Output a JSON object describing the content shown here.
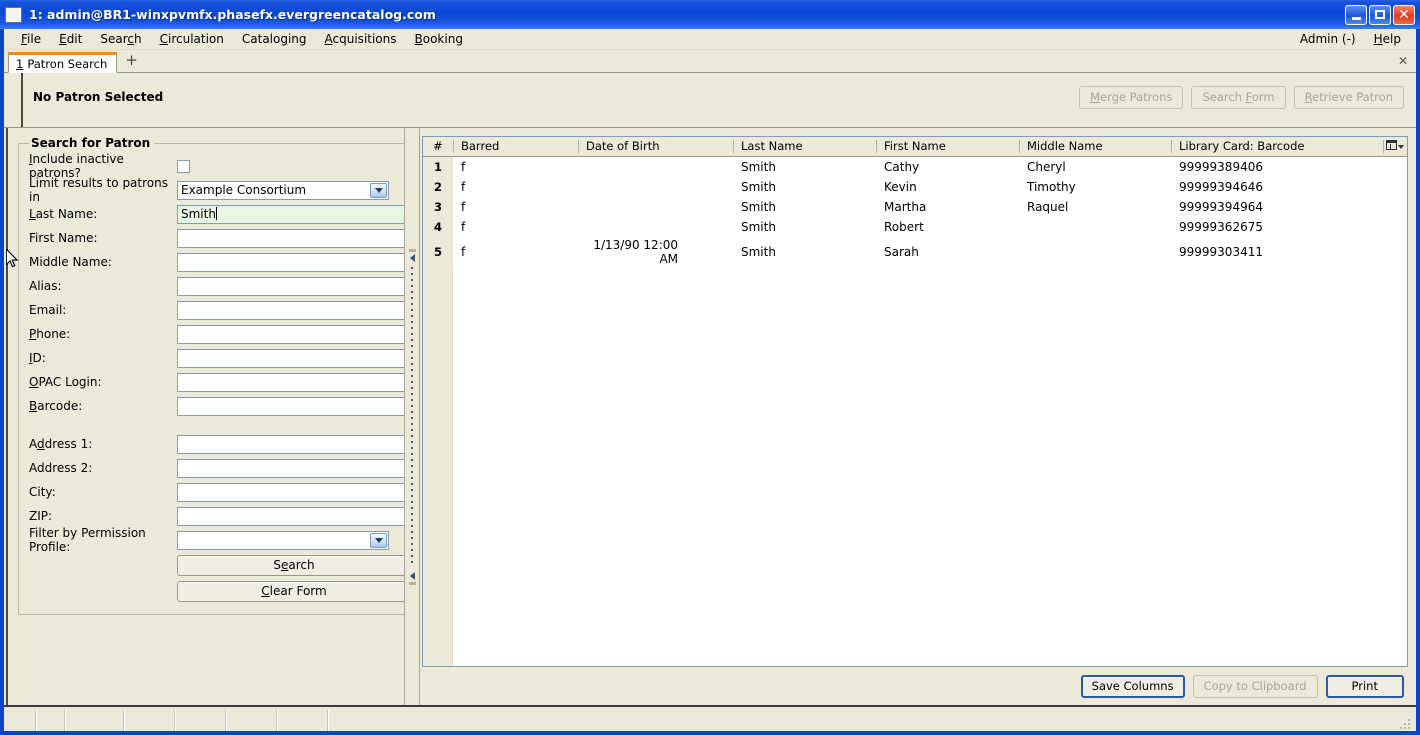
{
  "window": {
    "title": "1: admin@BR1-winxpvmfx.phasefx.evergreencatalog.com",
    "minimize_label": "",
    "maximize_label": "",
    "close_label": "✕"
  },
  "menubar": {
    "items": [
      {
        "label": "File",
        "accel": "F"
      },
      {
        "label": "Edit",
        "accel": "E"
      },
      {
        "label": "Search",
        "accel": "c"
      },
      {
        "label": "Circulation",
        "accel": "C"
      },
      {
        "label": "Cataloging",
        "accel": "g"
      },
      {
        "label": "Acquisitions",
        "accel": "A"
      },
      {
        "label": "Booking",
        "accel": "B"
      }
    ],
    "right": [
      {
        "label": "Admin (-)"
      },
      {
        "label": "Help",
        "accel": "H"
      }
    ]
  },
  "tabs": {
    "items": [
      {
        "num": "1",
        "label": "Patron Search",
        "active": true
      }
    ],
    "new_tab_label": "+",
    "close_label": "✕"
  },
  "patron_bar": {
    "status": "No Patron Selected",
    "buttons": [
      {
        "label": "Merge Patrons",
        "enabled": false
      },
      {
        "label": "Search Form",
        "enabled": false
      },
      {
        "label": "Retrieve Patron",
        "enabled": false
      }
    ]
  },
  "search_form": {
    "legend": "Search for Patron",
    "include_inactive_label": "Include inactive patrons?",
    "include_inactive_checked": false,
    "limit_label": "Limit results to patrons in",
    "limit_value": "Example Consortium",
    "fields": [
      {
        "label": "Last Name:",
        "value": "Smith",
        "focused": true
      },
      {
        "label": "First Name:",
        "value": "",
        "focused": false
      },
      {
        "label": "Middle Name:",
        "value": "",
        "focused": false
      },
      {
        "label": "Alias:",
        "value": "",
        "focused": false
      },
      {
        "label": "Email:",
        "value": "",
        "focused": false
      },
      {
        "label": "Phone:",
        "value": "",
        "focused": false
      },
      {
        "label": "ID:",
        "value": "",
        "focused": false
      },
      {
        "label": "OPAC Login:",
        "value": "",
        "focused": false
      },
      {
        "label": "Barcode:",
        "value": "",
        "focused": false
      }
    ],
    "address_fields": [
      {
        "label": "Address 1:",
        "value": ""
      },
      {
        "label": "Address 2:",
        "value": ""
      },
      {
        "label": "City:",
        "value": ""
      },
      {
        "label": "ZIP:",
        "value": ""
      }
    ],
    "permission_label": "Filter by Permission Profile:",
    "permission_value": "",
    "search_button": "Search",
    "clear_button": "Clear Form"
  },
  "results": {
    "columns": [
      "#",
      "Barred",
      "Date of Birth",
      "Last Name",
      "First Name",
      "Middle Name",
      "Library Card: Barcode"
    ],
    "rows": [
      {
        "num": "1",
        "barred": "f",
        "dob": "",
        "last": "Smith",
        "first": "Cathy",
        "middle": "Cheryl",
        "barcode": "99999389406"
      },
      {
        "num": "2",
        "barred": "f",
        "dob": "",
        "last": "Smith",
        "first": "Kevin",
        "middle": "Timothy",
        "barcode": "99999394646"
      },
      {
        "num": "3",
        "barred": "f",
        "dob": "",
        "last": "Smith",
        "first": "Martha",
        "middle": "Raquel",
        "barcode": "99999394964"
      },
      {
        "num": "4",
        "barred": "f",
        "dob": "",
        "last": "Smith",
        "first": "Robert",
        "middle": "",
        "barcode": "99999362675"
      },
      {
        "num": "5",
        "barred": "f",
        "dob": "1/13/90 12:00 AM",
        "last": "Smith",
        "first": "Sarah",
        "middle": "",
        "barcode": "99999303411"
      }
    ],
    "footer_buttons": [
      {
        "label": "Save Columns",
        "enabled": true,
        "default": true
      },
      {
        "label": "Copy to Clipboard",
        "enabled": false,
        "default": false
      },
      {
        "label": "Print",
        "enabled": true,
        "default": true
      }
    ]
  },
  "colors": {
    "titlebar": "#0a47d6",
    "window_bg": "#ece9d8",
    "tab_accent": "#ef8e21",
    "focused_field": "#e7f7e2",
    "field_border": "#7f9db9"
  }
}
